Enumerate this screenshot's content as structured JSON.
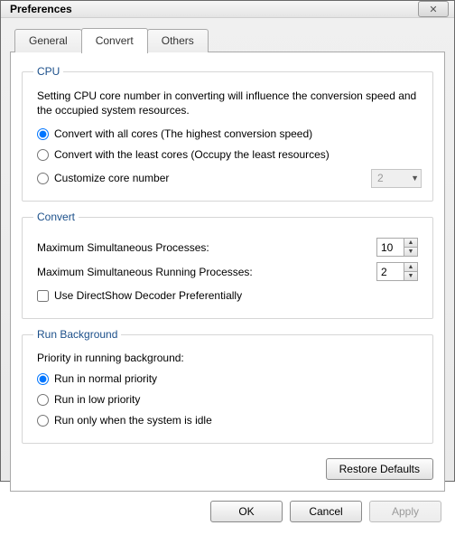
{
  "window": {
    "title": "Preferences"
  },
  "tabs": {
    "general": "General",
    "convert": "Convert",
    "others": "Others",
    "active": "convert"
  },
  "cpu": {
    "legend": "CPU",
    "desc": "Setting CPU core number in converting will influence the conversion speed and the occupied system resources.",
    "opt_all": "Convert with all cores (The highest conversion speed)",
    "opt_least": "Convert with the least cores (Occupy the least resources)",
    "opt_custom": "Customize core number",
    "selected": "all",
    "custom_value": "2"
  },
  "convert": {
    "legend": "Convert",
    "max_proc_label": "Maximum Simultaneous Processes:",
    "max_proc_value": "10",
    "max_run_label": "Maximum Simultaneous Running Processes:",
    "max_run_value": "2",
    "directshow_label": "Use DirectShow Decoder Preferentially",
    "directshow_checked": false
  },
  "runbg": {
    "legend": "Run Background",
    "priority_label": "Priority in running background:",
    "opt_normal": "Run in normal priority",
    "opt_low": "Run in low priority",
    "opt_idle": "Run only when the system is idle",
    "selected": "normal"
  },
  "buttons": {
    "restore": "Restore Defaults",
    "ok": "OK",
    "cancel": "Cancel",
    "apply": "Apply"
  }
}
